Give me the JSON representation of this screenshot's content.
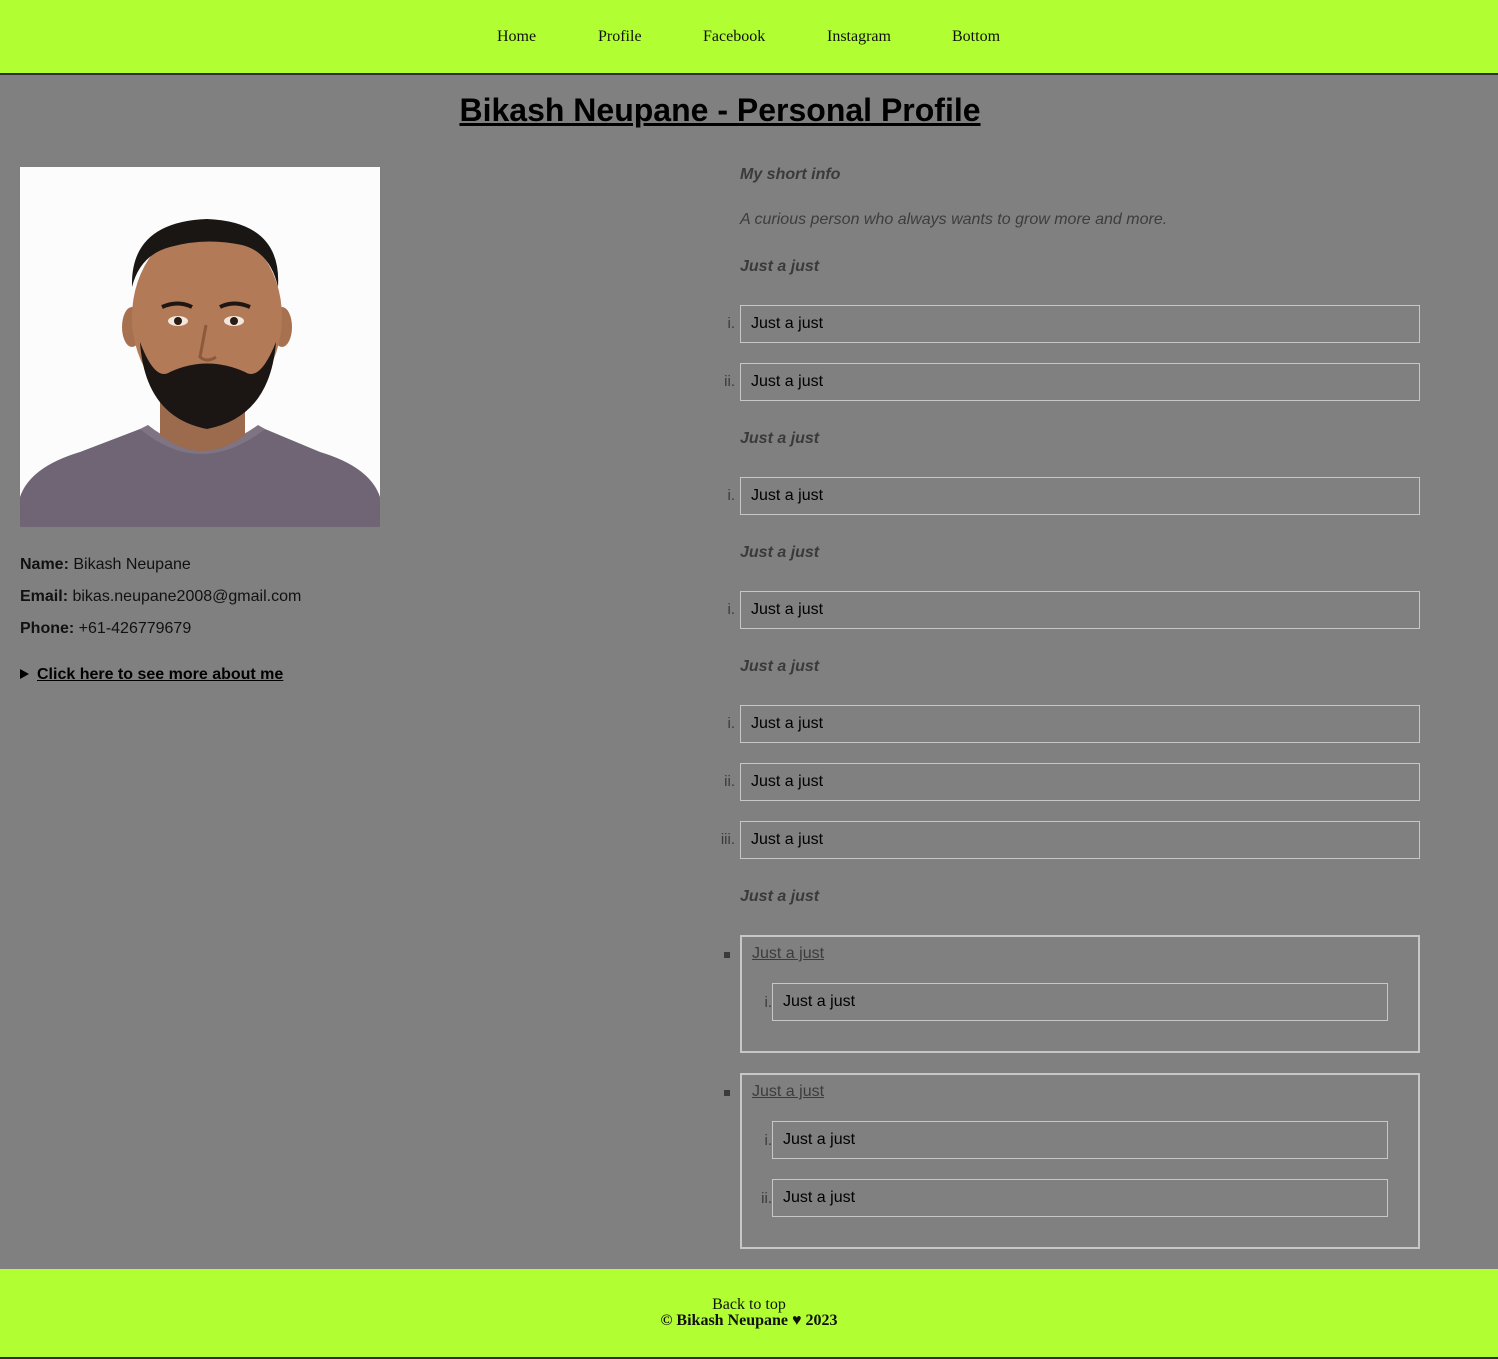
{
  "nav": {
    "items": [
      "Home",
      "Profile",
      "Facebook",
      "Instagram",
      "Bottom"
    ]
  },
  "title": "Bikash Neupane - Personal Profile",
  "profile": {
    "name_label": "Name:",
    "name": "Bikash Neupane",
    "email_label": "Email:",
    "email": "bikas.neupane2008@gmail.com",
    "phone_label": "Phone:",
    "phone": "+61-426779679",
    "details_summary": "Click here to see more about me"
  },
  "right": {
    "heading1": "My short info",
    "description": "A curious person who always wants to grow more and more.",
    "sections": [
      {
        "heading": "Just a just",
        "items": [
          "Just a just",
          "Just a just"
        ]
      },
      {
        "heading": "Just a just",
        "items": [
          "Just a just"
        ]
      },
      {
        "heading": "Just a just",
        "items": [
          "Just a just"
        ]
      },
      {
        "heading": "Just a just",
        "items": [
          "Just a just",
          "Just a just",
          "Just a just"
        ]
      },
      {
        "heading": "Just a just"
      }
    ],
    "groups": [
      {
        "title": "Just a just",
        "items": [
          "Just a just"
        ]
      },
      {
        "title": "Just a just",
        "items": [
          "Just a just",
          "Just a just"
        ]
      }
    ],
    "markers": [
      "i.",
      "ii.",
      "iii."
    ]
  },
  "footer": {
    "back_to_top": "Back to top",
    "copyright": "© Bikash Neupane ♥ 2023"
  },
  "colors": {
    "nav_bg": "#b1fe33",
    "page_bg": "#808080"
  }
}
